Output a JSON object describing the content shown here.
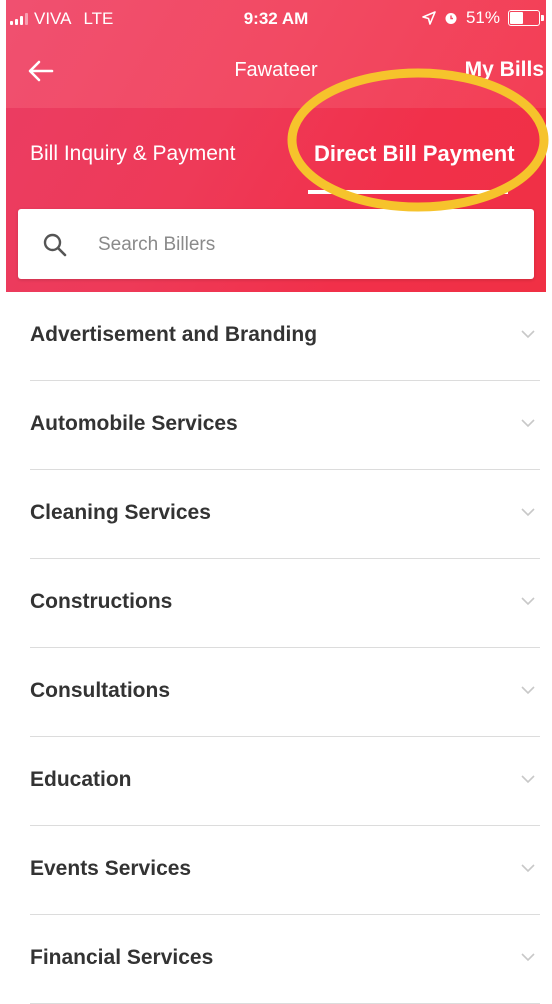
{
  "status_bar": {
    "carrier": "VIVA",
    "network": "LTE",
    "time": "9:32 AM",
    "battery": "51%",
    "battery_level": 0.51
  },
  "app_bar": {
    "title": "Fawateer",
    "right_link": "My Bills"
  },
  "tabs": [
    {
      "label": "Bill Inquiry & Payment",
      "active": false
    },
    {
      "label": "Direct Bill Payment",
      "active": true
    }
  ],
  "search": {
    "placeholder": "Search Billers"
  },
  "categories": [
    {
      "label": "Advertisement and Branding"
    },
    {
      "label": "Automobile Services"
    },
    {
      "label": "Cleaning Services"
    },
    {
      "label": "Constructions"
    },
    {
      "label": "Consultations"
    },
    {
      "label": "Education"
    },
    {
      "label": "Events Services"
    },
    {
      "label": "Financial Services"
    }
  ],
  "colors": {
    "accent": "#f0304a",
    "highlight": "#f6c32c",
    "text": "#333333",
    "divider": "#dcdcdc"
  },
  "icons": {
    "back": "arrow-left-icon",
    "search": "search-icon",
    "chevron": "chevron-down-icon",
    "location": "location-arrow-icon",
    "alarm": "alarm-icon"
  }
}
